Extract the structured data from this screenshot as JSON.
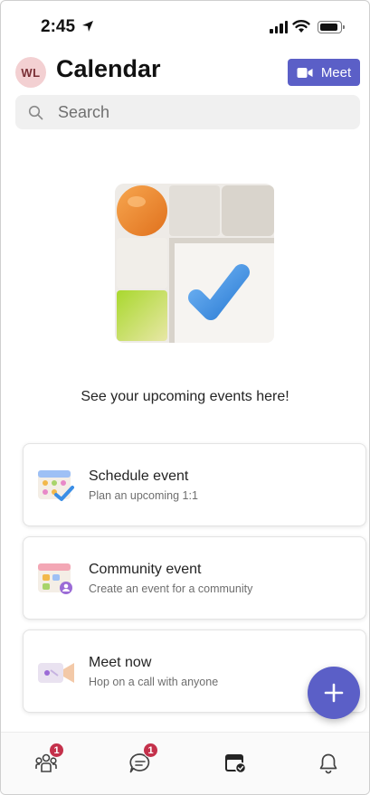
{
  "status_bar": {
    "time": "2:45"
  },
  "header": {
    "avatar_initials": "WL",
    "title": "Calendar",
    "meet_label": "Meet"
  },
  "search": {
    "placeholder": "Search"
  },
  "empty_state": {
    "message": "See your upcoming events here!"
  },
  "cards": [
    {
      "title": "Schedule event",
      "subtitle": "Plan an upcoming 1:1",
      "icon": "calendar-check-icon"
    },
    {
      "title": "Community event",
      "subtitle": "Create an event for a community",
      "icon": "calendar-community-icon"
    },
    {
      "title": "Meet now",
      "subtitle": "Hop on a call with anyone",
      "icon": "video-camera-icon"
    }
  ],
  "fab": {
    "icon": "plus-icon"
  },
  "tab_bar": {
    "items": [
      {
        "icon": "community-icon",
        "badge": "1"
      },
      {
        "icon": "chat-icon",
        "badge": "1"
      },
      {
        "icon": "calendar-icon",
        "active": true
      },
      {
        "icon": "bell-icon"
      }
    ]
  },
  "colors": {
    "accent": "#5b5fc7",
    "badge": "#c4314b",
    "avatar_bg": "#f3d0d2"
  }
}
